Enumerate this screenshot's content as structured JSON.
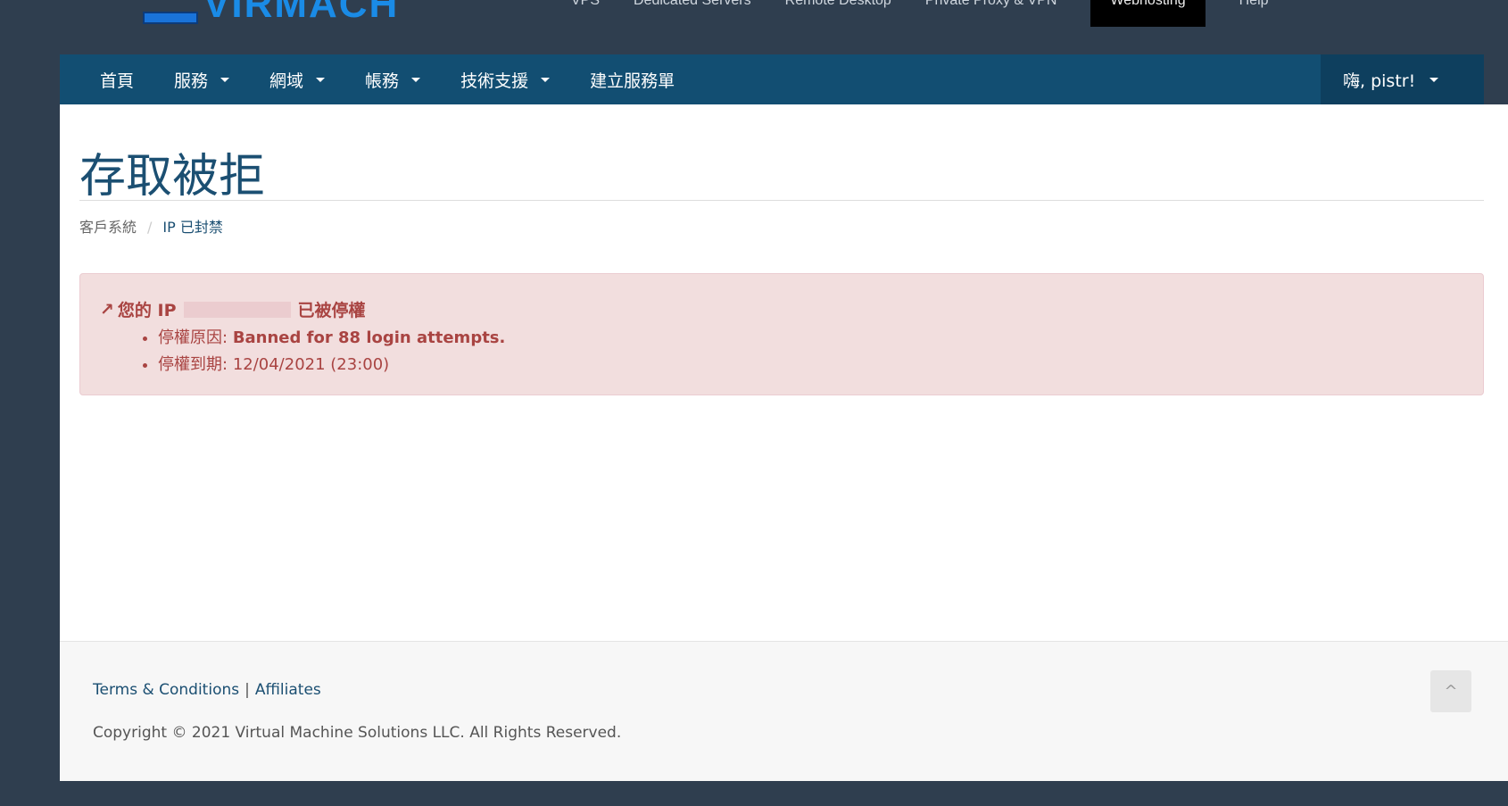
{
  "brand": {
    "logo_text": "VIRMACH"
  },
  "top_nav": [
    "VPS",
    "Dedicated Servers",
    "Remote Desktop",
    "Private Proxy & VPN",
    "Webhosting",
    "Help"
  ],
  "navbar": {
    "items": [
      {
        "label": "首頁"
      },
      {
        "label": "服務"
      },
      {
        "label": "網域"
      },
      {
        "label": "帳務"
      },
      {
        "label": "技術支援"
      },
      {
        "label": "建立服務單"
      }
    ],
    "user": "嗨, pistr!"
  },
  "page": {
    "title": "存取被拒",
    "breadcrumb": [
      "客戶系統",
      "IP 已封禁"
    ]
  },
  "alert": {
    "prefix": "您的 IP",
    "suffix": "已被停權",
    "reason_label": "停權原因:",
    "reason": "Banned for 88 login attempts.",
    "expiry_label": "停權到期:",
    "expiry": "12/04/2021 (23:00)"
  },
  "footer": {
    "links": [
      "Terms & Conditions",
      "Affiliates"
    ],
    "copyright": "Copyright © 2021 Virtual Machine Solutions LLC. All Rights Reserved.",
    "back_to_top": "^"
  },
  "colors": {
    "navbar": "#124e72",
    "alert_bg": "#f2dede",
    "alert_text": "#a94442",
    "background": "#2f3e4f"
  }
}
